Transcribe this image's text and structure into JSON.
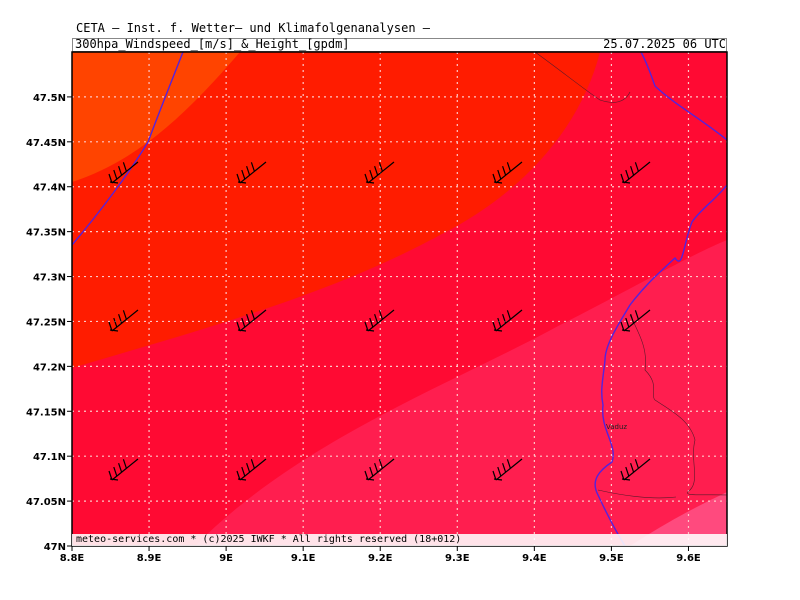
{
  "header": {
    "line1": "CETA — Inst. f. Wetter— und Klimafolgenanalysen —",
    "line2": "300hpa_Windspeed_[m/s]_&_Height_[gpdm]",
    "datetime": "25.07.2025 06 UTC"
  },
  "footer": {
    "text": "meteo-services.com * (c)2025 IWKF * All rights reserved (18+012)"
  },
  "map": {
    "lon_range": [
      8.8,
      9.65
    ],
    "lat_range": [
      47.0,
      47.55
    ],
    "lat_ticks": [
      "47.5N",
      "47.45N",
      "47.4N",
      "47.35N",
      "47.3N",
      "47.25N",
      "47.2N",
      "47.15N",
      "47.1N",
      "47.05N",
      "47N"
    ],
    "lon_ticks": [
      "8.8E",
      "8.9E",
      "9E",
      "9.1E",
      "9.2E",
      "9.3E",
      "9.4E",
      "9.5E",
      "9.6E"
    ],
    "place_labels": [
      "Vaduz"
    ],
    "gridlines": true,
    "colors": {
      "band_1": "#ff4400",
      "band_2": "#ff1c00",
      "band_3": "#ff0a33",
      "band_4": "#ff1e4f",
      "band_5": "#ff4a7e",
      "border_line": "#5522dd",
      "grid_line": "#ffc8c8",
      "barb": "#000000"
    }
  }
}
